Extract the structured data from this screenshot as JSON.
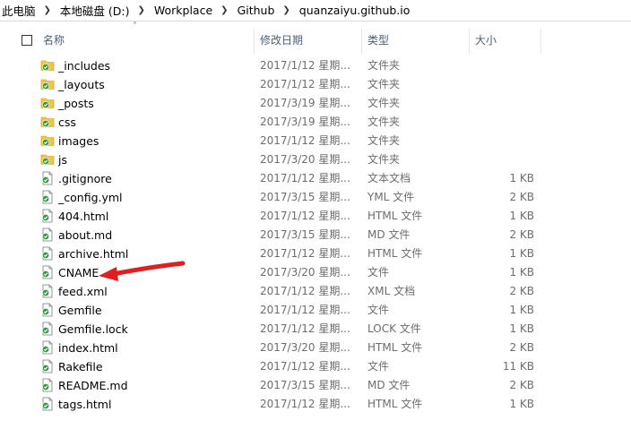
{
  "breadcrumb": [
    "此电脑",
    "本地磁盘 (D:)",
    "Workplace",
    "Github",
    "quanzaiyu.github.io"
  ],
  "columns": {
    "name": "名称",
    "date": "修改日期",
    "type": "类型",
    "size": "大小"
  },
  "files": [
    {
      "name": "_includes",
      "date": "2017/1/12 星期...",
      "type": "文件夹",
      "size": "",
      "kind": "folder"
    },
    {
      "name": "_layouts",
      "date": "2017/1/12 星期...",
      "type": "文件夹",
      "size": "",
      "kind": "folder"
    },
    {
      "name": "_posts",
      "date": "2017/3/19 星期...",
      "type": "文件夹",
      "size": "",
      "kind": "folder"
    },
    {
      "name": "css",
      "date": "2017/3/19 星期...",
      "type": "文件夹",
      "size": "",
      "kind": "folder"
    },
    {
      "name": "images",
      "date": "2017/1/12 星期...",
      "type": "文件夹",
      "size": "",
      "kind": "folder"
    },
    {
      "name": "js",
      "date": "2017/3/20 星期...",
      "type": "文件夹",
      "size": "",
      "kind": "folder"
    },
    {
      "name": ".gitignore",
      "date": "2017/1/12 星期...",
      "type": "文本文档",
      "size": "1 KB",
      "kind": "file"
    },
    {
      "name": "_config.yml",
      "date": "2017/3/15 星期...",
      "type": "YML 文件",
      "size": "2 KB",
      "kind": "file"
    },
    {
      "name": "404.html",
      "date": "2017/1/12 星期...",
      "type": "HTML 文件",
      "size": "1 KB",
      "kind": "file"
    },
    {
      "name": "about.md",
      "date": "2017/3/15 星期...",
      "type": "MD 文件",
      "size": "2 KB",
      "kind": "file"
    },
    {
      "name": "archive.html",
      "date": "2017/1/12 星期...",
      "type": "HTML 文件",
      "size": "1 KB",
      "kind": "file"
    },
    {
      "name": "CNAME",
      "date": "2017/3/20 星期...",
      "type": "文件",
      "size": "1 KB",
      "kind": "file"
    },
    {
      "name": "feed.xml",
      "date": "2017/1/12 星期...",
      "type": "XML 文档",
      "size": "2 KB",
      "kind": "file"
    },
    {
      "name": "Gemfile",
      "date": "2017/1/12 星期...",
      "type": "文件",
      "size": "1 KB",
      "kind": "file"
    },
    {
      "name": "Gemfile.lock",
      "date": "2017/1/12 星期...",
      "type": "LOCK 文件",
      "size": "1 KB",
      "kind": "file"
    },
    {
      "name": "index.html",
      "date": "2017/3/20 星期...",
      "type": "HTML 文件",
      "size": "2 KB",
      "kind": "file"
    },
    {
      "name": "Rakefile",
      "date": "2017/1/12 星期...",
      "type": "文件",
      "size": "11 KB",
      "kind": "file"
    },
    {
      "name": "README.md",
      "date": "2017/3/15 星期...",
      "type": "MD 文件",
      "size": "2 KB",
      "kind": "file"
    },
    {
      "name": "tags.html",
      "date": "2017/1/12 星期...",
      "type": "HTML 文件",
      "size": "1 KB",
      "kind": "file"
    }
  ],
  "colors": {
    "folder": "#f4c542",
    "check": "#2e9d3a",
    "arrow": "#e02020",
    "header_text": "#4c607a"
  },
  "annotation": {
    "type": "red-arrow",
    "target": "CNAME"
  }
}
